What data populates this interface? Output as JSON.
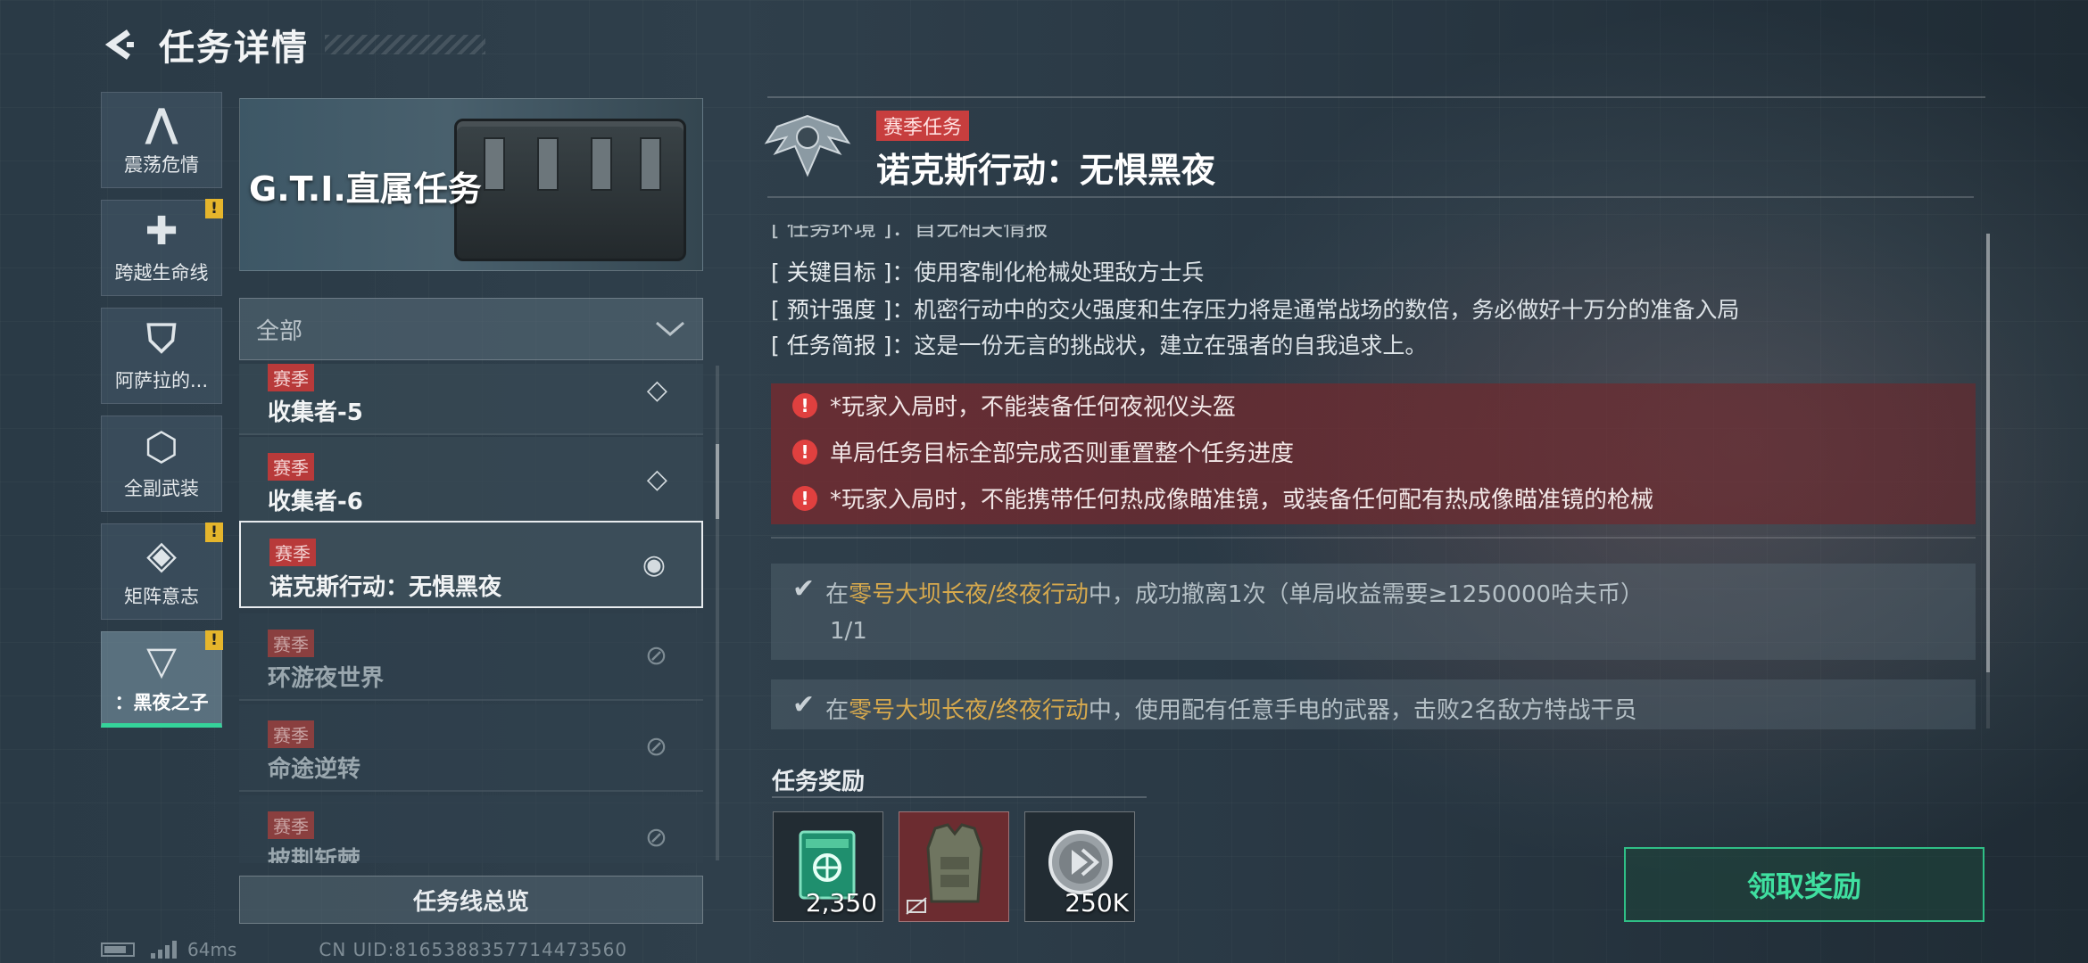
{
  "header": {
    "title": "任务详情"
  },
  "rail": {
    "items": [
      {
        "label": "震荡危情",
        "icon": "a-chevron-icon",
        "alert": false,
        "active": false
      },
      {
        "label": "跨越生命线",
        "icon": "plus-icon",
        "alert": true,
        "active": false
      },
      {
        "label": "阿萨拉的...",
        "icon": "shield-icon",
        "alert": false,
        "active": false
      },
      {
        "label": "全副武装",
        "icon": "hexagon-icon",
        "alert": false,
        "active": false
      },
      {
        "label": "矩阵意志",
        "icon": "diamond-icon",
        "alert": true,
        "active": false
      },
      {
        "label": "：黑夜之子",
        "icon": "v-chevron-icon",
        "alert": true,
        "active": true
      }
    ],
    "alert_symbol": "!"
  },
  "banner": {
    "title": "G.T.I.直属任务"
  },
  "filter": {
    "value": "全部"
  },
  "tasks": [
    {
      "tag": "赛季",
      "name": "收集者-5",
      "state": "available"
    },
    {
      "tag": "赛季",
      "name": "收集者-6",
      "state": "available"
    },
    {
      "tag": "赛季",
      "name": "诺克斯行动：无惧黑夜",
      "state": "selected"
    },
    {
      "tag": "赛季",
      "name": "环游夜世界",
      "state": "locked"
    },
    {
      "tag": "赛季",
      "name": "命途逆转",
      "state": "locked"
    },
    {
      "tag": "赛季",
      "name": "披荆斩棘",
      "state": "locked"
    }
  ],
  "overview_button": "任务线总览",
  "footer": {
    "ping": "64ms",
    "uid": "CN UID:8165388357714473560"
  },
  "detail": {
    "tag": "赛季任务",
    "title": "诺克斯行动：无惧黑夜",
    "cut_line": "[ 任务环境 ]：首无相关情报",
    "info": [
      {
        "key": "[ 关键目标 ]",
        "value": "：使用客制化枪械处理敌方士兵"
      },
      {
        "key": "[ 预计强度 ]",
        "value": "：机密行动中的交火强度和生存压力将是通常战场的数倍，务必做好十万分的准备入局"
      },
      {
        "key": "[ 任务简报 ]",
        "value": "：这是一份无言的挑战状，建立在强者的自我追求上。"
      }
    ],
    "warnings": [
      "*玩家入局时，不能装备任何夜视仪头盔",
      "单局任务目标全部完成否则重置整个任务进度",
      "*玩家入局时，不能携带任何热成像瞄准镜，或装备任何配有热成像瞄准镜的枪械"
    ],
    "objectives": [
      {
        "prefix": "在",
        "highlight": "零号大坝长夜/终夜行动",
        "suffix": "中，成功撤离1次（单局收益需要≥1250000哈夫币）",
        "progress": "1/1"
      },
      {
        "prefix": "在",
        "highlight": "零号大坝长夜/终夜行动",
        "suffix": "中，使用配有任意手电的武器，击败2名敌方特战干员",
        "progress": ""
      }
    ]
  },
  "rewards": {
    "title": "任务奖励",
    "items": [
      {
        "icon": "exp-card-icon",
        "qty": "2,350"
      },
      {
        "icon": "armor-vest-icon",
        "qty": ""
      },
      {
        "icon": "coin-icon",
        "qty": "250K"
      }
    ],
    "claim_label": "领取奖励"
  },
  "colors": {
    "accent": "#35d39a",
    "warning": "#c73e3e",
    "highlight": "#d7a94d"
  }
}
